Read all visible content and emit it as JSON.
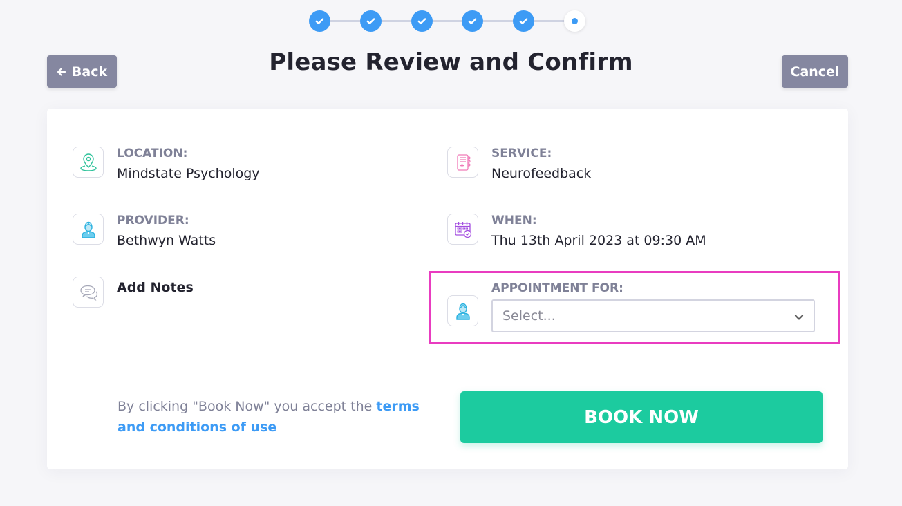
{
  "stepper": {
    "total_steps": 6,
    "completed_steps": 5,
    "current_step": 6
  },
  "header": {
    "title": "Please Review and Confirm",
    "back_label": "Back",
    "cancel_label": "Cancel"
  },
  "details": {
    "location": {
      "label": "LOCATION:",
      "value": "Mindstate Psychology",
      "icon": "map-pin-icon"
    },
    "service": {
      "label": "SERVICE:",
      "value": "Neurofeedback",
      "icon": "medical-notebook-icon"
    },
    "provider": {
      "label": "PROVIDER:",
      "value": "Bethwyn Watts",
      "icon": "person-icon"
    },
    "when": {
      "label": "WHEN:",
      "value": "Thu 13th April 2023 at 09:30 AM",
      "icon": "calendar-check-icon"
    },
    "notes": {
      "value": "Add Notes",
      "icon": "chat-bubbles-icon"
    },
    "appointment_for": {
      "label": "APPOINTMENT FOR:",
      "placeholder": "Select...",
      "value": "",
      "icon": "person-icon"
    }
  },
  "footer": {
    "terms_prefix": "By clicking \"Book Now\" you accept the ",
    "terms_link": "terms and conditions of use",
    "book_label": "BOOK NOW"
  },
  "colors": {
    "accent": "#3d9bf5",
    "book": "#1ccb9f",
    "secondary_button": "#8587a0",
    "highlight": "#e93cc0"
  }
}
